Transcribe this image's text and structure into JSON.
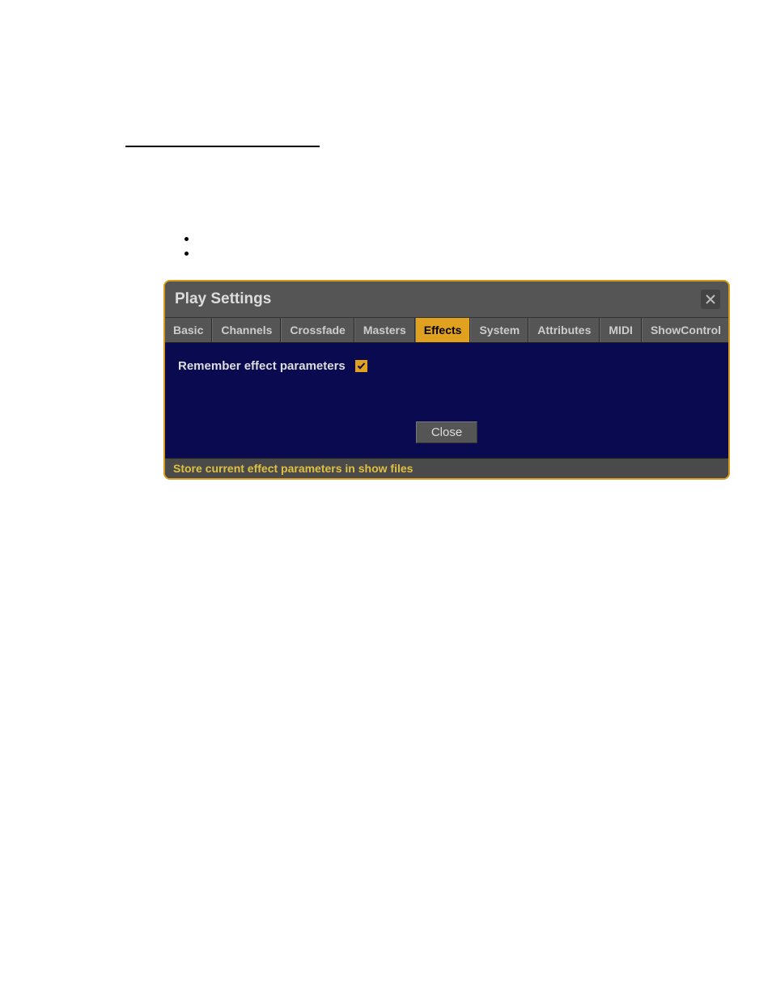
{
  "dialog": {
    "title": "Play Settings",
    "tabs": [
      "Basic",
      "Channels",
      "Crossfade",
      "Masters",
      "Effects",
      "System",
      "Attributes",
      "MIDI",
      "ShowControl"
    ],
    "active_tab": "Effects",
    "setting_label": "Remember effect parameters",
    "checkbox_checked": true,
    "close_label": "Close",
    "status_text": "Store current effect parameters in show files"
  }
}
